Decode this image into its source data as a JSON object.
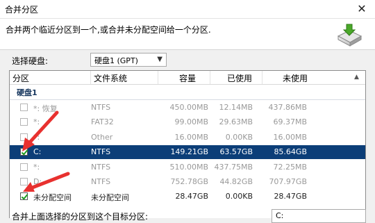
{
  "window": {
    "title": "合并分区",
    "close_glyph": "✕"
  },
  "header": {
    "description": "合并两个临近分区到一个,或合并未分配空间给一个分区.",
    "icon": "merge-disk-icon"
  },
  "disk_select": {
    "label": "选择硬盘:",
    "value": "硬盘1 (GPT)"
  },
  "table": {
    "columns": [
      "分区",
      "文件系统",
      "容量",
      "已使用",
      "未使用"
    ],
    "group": "硬盘1",
    "rows": [
      {
        "name": "*: 恢复",
        "fs": "NTFS",
        "capacity": "450.00MB",
        "used": "12.14MB",
        "unused": "437.86MB",
        "checked": false,
        "enabled": false,
        "selected": false
      },
      {
        "name": "*:",
        "fs": "FAT32",
        "capacity": "99.00MB",
        "used": "29.63MB",
        "unused": "69.37MB",
        "checked": false,
        "enabled": false,
        "selected": false
      },
      {
        "name": "*:",
        "fs": "Other",
        "capacity": "16.00MB",
        "used": "0.00KB",
        "unused": "16.00MB",
        "checked": false,
        "enabled": false,
        "selected": false
      },
      {
        "name": "C:",
        "fs": "NTFS",
        "capacity": "149.21GB",
        "used": "63.57GB",
        "unused": "85.64GB",
        "checked": true,
        "enabled": true,
        "selected": true
      },
      {
        "name": "*:",
        "fs": "NTFS",
        "capacity": "510.00MB",
        "used": "437.75MB",
        "unused": "72.25MB",
        "checked": false,
        "enabled": false,
        "selected": false
      },
      {
        "name": "D:",
        "fs": "NTFS",
        "capacity": "752.78GB",
        "used": "44.82GB",
        "unused": "707.97GB",
        "checked": false,
        "enabled": false,
        "selected": false
      },
      {
        "name": "未分配空间",
        "fs": "未分配空间",
        "capacity": "28.47GB",
        "used": "0.00KB",
        "unused": "28.47GB",
        "checked": true,
        "enabled": true,
        "selected": false
      }
    ]
  },
  "footer": {
    "label": "合并上面选择的分区到这个目标分区:",
    "target": "C:"
  },
  "colors": {
    "selection": "#0c3e78",
    "annotation_arrow": "#e8312f",
    "check": "#1d9a1d"
  }
}
